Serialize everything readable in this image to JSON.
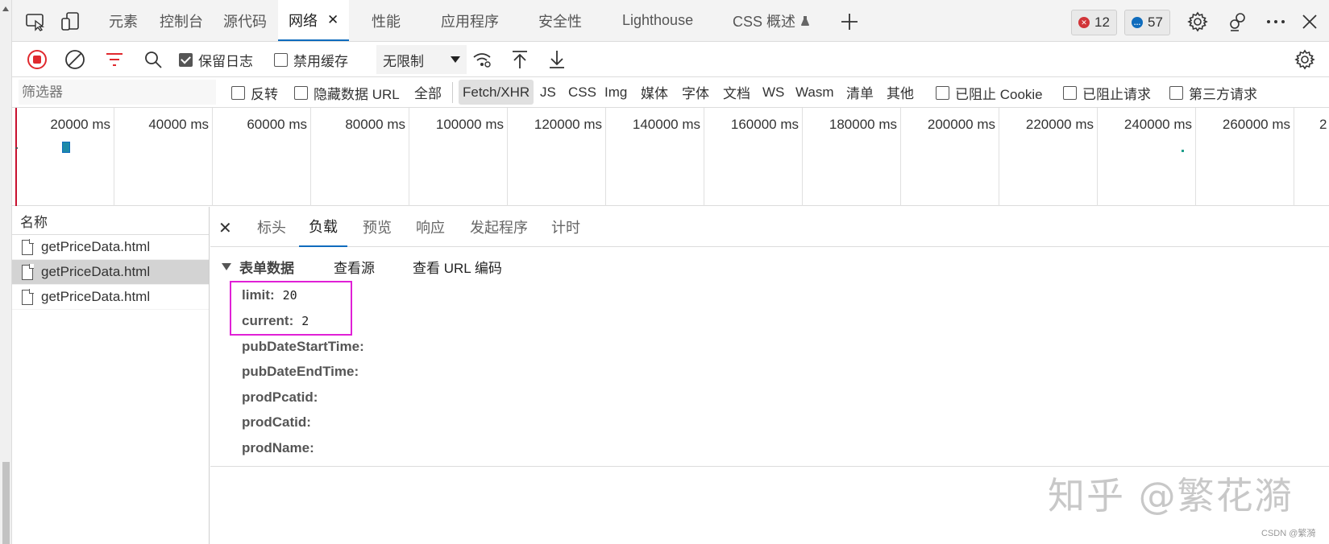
{
  "tabs": [
    {
      "label": "元素",
      "active": false
    },
    {
      "label": "控制台",
      "active": false
    },
    {
      "label": "源代码",
      "active": false
    },
    {
      "label": "网络",
      "active": true
    },
    {
      "label": "性能",
      "active": false
    },
    {
      "label": "应用程序",
      "active": false
    },
    {
      "label": "安全性",
      "active": false
    },
    {
      "label": "Lighthouse",
      "active": false
    },
    {
      "label": "CSS 概述",
      "active": false
    }
  ],
  "tab_close": "✕",
  "badges": {
    "errors": "12",
    "messages": "57"
  },
  "toolbar": {
    "preserve_log": "保留日志",
    "preserve_log_checked": true,
    "disable_cache": "禁用缓存",
    "disable_cache_checked": false,
    "throttle": "无限制"
  },
  "filter": {
    "placeholder": "筛选器",
    "invert": "反转",
    "hide_data_urls": "隐藏数据 URL",
    "all": "全部",
    "types": [
      "Fetch/XHR",
      "JS",
      "CSS",
      "Img",
      "媒体",
      "字体",
      "文档",
      "WS",
      "Wasm",
      "清单",
      "其他"
    ],
    "selected_type": "Fetch/XHR",
    "blocked_cookies": "已阻止 Cookie",
    "blocked_requests": "已阻止请求",
    "third_party": "第三方请求"
  },
  "timeline": {
    "ticks": [
      "20000 ms",
      "40000 ms",
      "60000 ms",
      "80000 ms",
      "100000 ms",
      "120000 ms",
      "140000 ms",
      "160000 ms",
      "180000 ms",
      "200000 ms",
      "220000 ms",
      "240000 ms",
      "260000 ms",
      "2"
    ]
  },
  "name_panel": {
    "header": "名称",
    "rows": [
      {
        "name": "getPriceData.html",
        "selected": false
      },
      {
        "name": "getPriceData.html",
        "selected": true
      },
      {
        "name": "getPriceData.html",
        "selected": false
      }
    ]
  },
  "detail": {
    "close": "✕",
    "tabs": [
      {
        "label": "标头",
        "active": false
      },
      {
        "label": "负载",
        "active": true
      },
      {
        "label": "预览",
        "active": false
      },
      {
        "label": "响应",
        "active": false
      },
      {
        "label": "发起程序",
        "active": false
      },
      {
        "label": "计时",
        "active": false
      }
    ],
    "section_title": "表单数据",
    "view_source": "查看源",
    "view_url_encoded": "查看 URL 编码",
    "fields": [
      {
        "key": "limit:",
        "value": "20"
      },
      {
        "key": "current:",
        "value": "2"
      },
      {
        "key": "pubDateStartTime:",
        "value": ""
      },
      {
        "key": "pubDateEndTime:",
        "value": ""
      },
      {
        "key": "prodPcatid:",
        "value": ""
      },
      {
        "key": "prodCatid:",
        "value": ""
      },
      {
        "key": "prodName:",
        "value": ""
      }
    ]
  },
  "watermark": "知乎 @繁花漪",
  "credit": "CSDN @繁漪",
  "colors": {
    "accent": "#0f6cbd",
    "highlight": "#e020d6",
    "record_red": "#e0292e",
    "error_red": "#d13438",
    "message_blue": "#0f6cbd"
  }
}
